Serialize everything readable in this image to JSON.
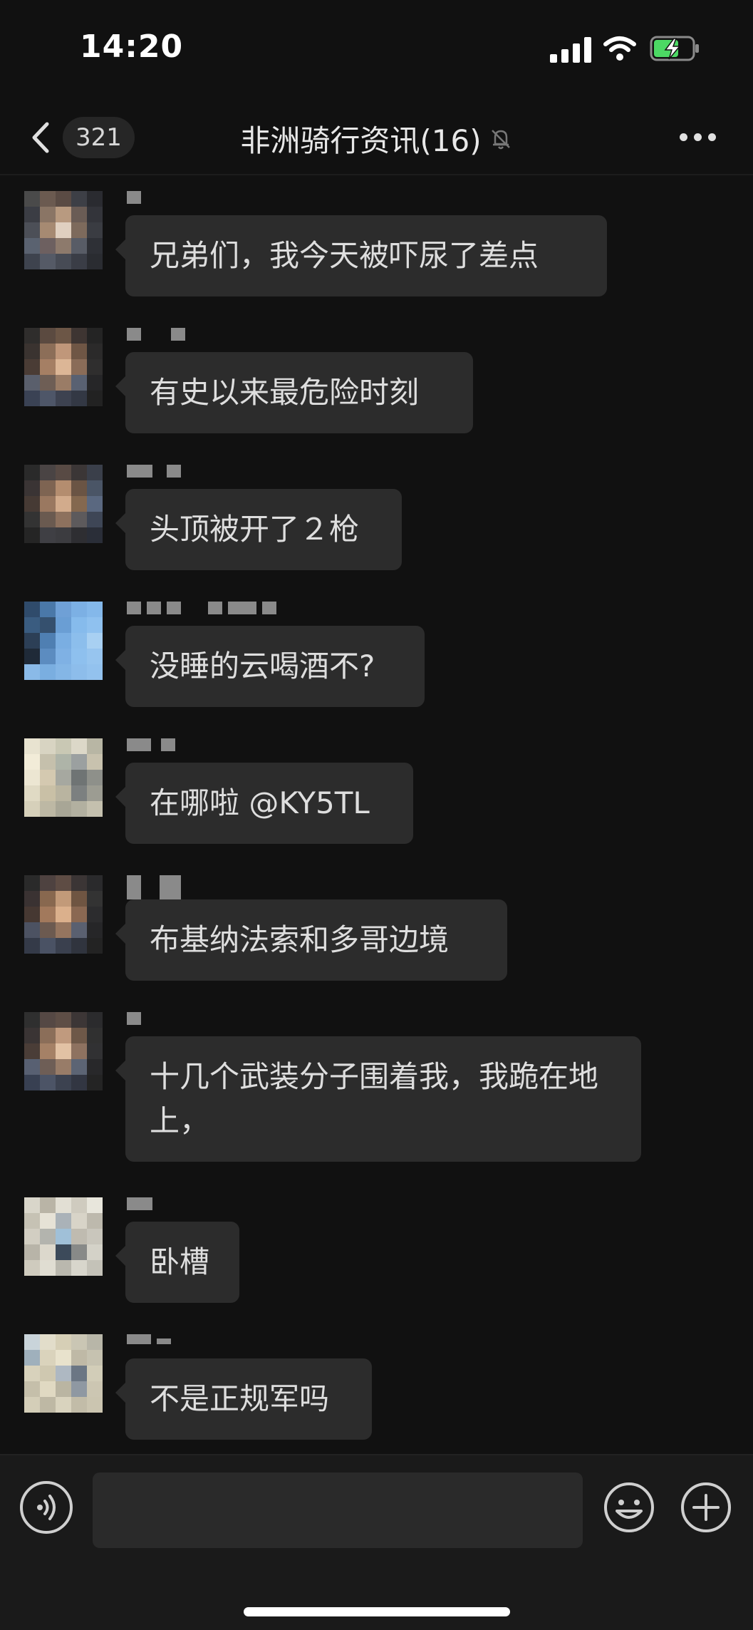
{
  "status_bar": {
    "time": "14:20"
  },
  "nav": {
    "unread_count": "321",
    "title": "非洲骑行资讯(16)"
  },
  "messages": [
    {
      "text": "兄弟们，我今天被吓尿了差点"
    },
    {
      "text": "有史以来最危险时刻"
    },
    {
      "text": "头顶被开了２枪"
    },
    {
      "text": "没睡的云喝酒不?"
    },
    {
      "text": "在哪啦 @KY5TL"
    },
    {
      "text": "布基纳法索和多哥边境"
    },
    {
      "text": "十几个武装分子围着我，我跪在地上，"
    },
    {
      "text": "卧槽"
    },
    {
      "text": "不是正规军吗"
    }
  ],
  "input": {
    "value": "",
    "placeholder": ""
  },
  "colors": {
    "background": "#111111",
    "bubble": "#2c2c2c",
    "battery_green": "#4cd964",
    "input_bar": "#1a1a1a"
  },
  "icons": {
    "back": "chevron-left-icon",
    "mute": "bell-slash-icon",
    "more": "ellipsis-icon",
    "voice": "voice-icon",
    "emoji": "smiley-icon",
    "plus": "plus-icon"
  }
}
